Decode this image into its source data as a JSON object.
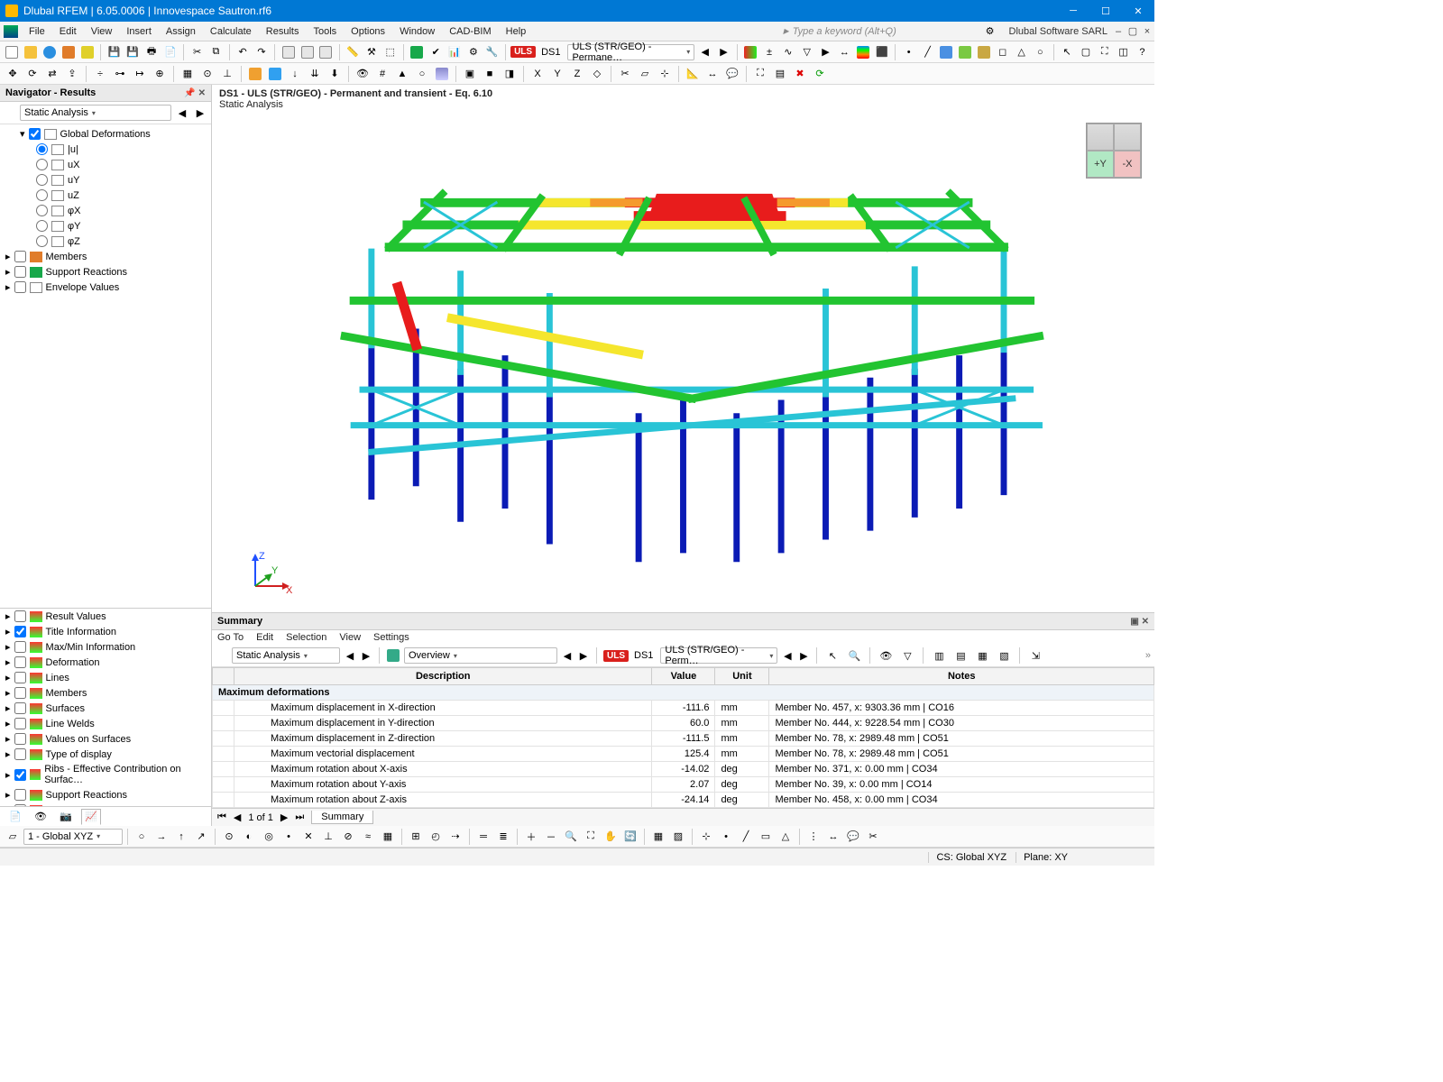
{
  "title": "Dlubal RFEM | 6.05.0006 | Innovespace Sautron.rf6",
  "company": "Dlubal Software SARL",
  "menu": [
    "File",
    "Edit",
    "View",
    "Insert",
    "Assign",
    "Calculate",
    "Results",
    "Tools",
    "Options",
    "Window",
    "CAD-BIM",
    "Help"
  ],
  "keyword_placeholder": "Type a keyword (Alt+Q)",
  "toolbar2": {
    "uls": "ULS",
    "ds": "DS1",
    "combo": "ULS (STR/GEO) - Permane…"
  },
  "navigator": {
    "title": "Navigator - Results",
    "dropdown": "Static Analysis",
    "global_def": "Global Deformations",
    "deform_opts": [
      "|u|",
      "uX",
      "uY",
      "uZ",
      "φX",
      "φY",
      "φZ"
    ],
    "deform_selected": "|u|",
    "branches": [
      "Members",
      "Support Reactions",
      "Envelope Values"
    ],
    "lower": [
      {
        "label": "Result Values",
        "checked": false
      },
      {
        "label": "Title Information",
        "checked": true
      },
      {
        "label": "Max/Min Information",
        "checked": false
      },
      {
        "label": "Deformation",
        "checked": false
      },
      {
        "label": "Lines",
        "checked": false
      },
      {
        "label": "Members",
        "checked": false
      },
      {
        "label": "Surfaces",
        "checked": false
      },
      {
        "label": "Line Welds",
        "checked": false
      },
      {
        "label": "Values on Surfaces",
        "checked": false
      },
      {
        "label": "Type of display",
        "checked": false
      },
      {
        "label": "Ribs - Effective Contribution on Surfac…",
        "checked": true
      },
      {
        "label": "Support Reactions",
        "checked": false
      },
      {
        "label": "Result Sections",
        "checked": false
      }
    ]
  },
  "view": {
    "line1": "DS1 - ULS (STR/GEO) - Permanent and transient - Eq. 6.10",
    "line2": "Static Analysis",
    "axes": {
      "x": "X",
      "y": "Y",
      "z": "Z"
    },
    "cube_y": "+Y",
    "cube_x": "-X"
  },
  "summary": {
    "title": "Summary",
    "menu": [
      "Go To",
      "Edit",
      "Selection",
      "View",
      "Settings"
    ],
    "dropdown1": "Static Analysis",
    "dropdown2": "Overview",
    "ds": "DS1",
    "combo": "ULS (STR/GEO) - Perm…",
    "uls": "ULS",
    "headers": [
      "Description",
      "Value",
      "Unit",
      "Notes"
    ],
    "section": "Maximum deformations",
    "rows": [
      {
        "d": "Maximum displacement in X-direction",
        "v": "-111.6",
        "u": "mm",
        "n": "Member No. 457, x: 9303.36 mm | CO16"
      },
      {
        "d": "Maximum displacement in Y-direction",
        "v": "60.0",
        "u": "mm",
        "n": "Member No. 444, x: 9228.54 mm | CO30"
      },
      {
        "d": "Maximum displacement in Z-direction",
        "v": "-111.5",
        "u": "mm",
        "n": "Member No. 78, x: 2989.48 mm | CO51"
      },
      {
        "d": "Maximum vectorial displacement",
        "v": "125.4",
        "u": "mm",
        "n": "Member No. 78, x: 2989.48 mm | CO51"
      },
      {
        "d": "Maximum rotation about X-axis",
        "v": "-14.02",
        "u": "deg",
        "n": "Member No. 371, x: 0.00 mm | CO34"
      },
      {
        "d": "Maximum rotation about Y-axis",
        "v": "2.07",
        "u": "deg",
        "n": "Member No. 39, x: 0.00 mm | CO14"
      },
      {
        "d": "Maximum rotation about Z-axis",
        "v": "-24.14",
        "u": "deg",
        "n": "Member No. 458, x: 0.00 mm | CO34"
      }
    ],
    "pager": "1 of 1",
    "pager_tab": "Summary"
  },
  "bottom": {
    "coord_sys_label": "1 - Global XYZ"
  },
  "status": {
    "cs": "CS: Global XYZ",
    "plane": "Plane: XY"
  },
  "colors": {
    "blue": "#1e4fd6",
    "cyan": "#29c4d6",
    "green": "#22c431",
    "yellow": "#f5e62d",
    "orange": "#f59a2d",
    "red": "#e81c1c",
    "dblue": "#0b1bb5"
  }
}
